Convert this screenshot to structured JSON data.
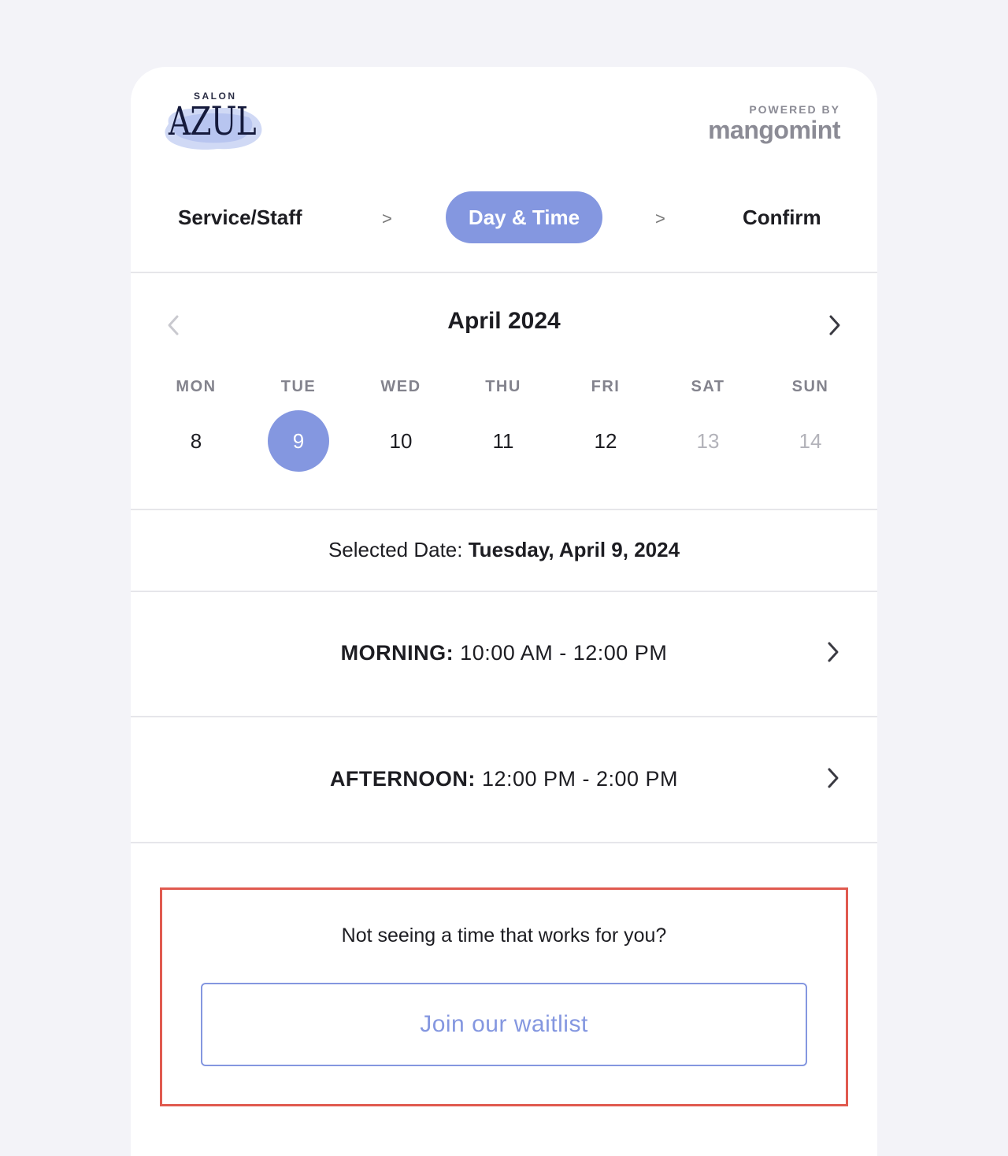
{
  "brand": {
    "logo_top": "SALON",
    "logo_name": "AZUL",
    "powered_label": "POWERED BY",
    "powered_brand": "mangomint"
  },
  "steps": [
    {
      "label": "Service/Staff",
      "active": false
    },
    {
      "label": "Day & Time",
      "active": true
    },
    {
      "label": "Confirm",
      "active": false
    }
  ],
  "step_separator": ">",
  "calendar": {
    "month": "April 2024",
    "weekdays": [
      "MON",
      "TUE",
      "WED",
      "THU",
      "FRI",
      "SAT",
      "SUN"
    ],
    "days": [
      {
        "num": "8",
        "state": "normal"
      },
      {
        "num": "9",
        "state": "selected"
      },
      {
        "num": "10",
        "state": "normal"
      },
      {
        "num": "11",
        "state": "normal"
      },
      {
        "num": "12",
        "state": "normal"
      },
      {
        "num": "13",
        "state": "muted"
      },
      {
        "num": "14",
        "state": "muted"
      }
    ]
  },
  "selected_date": {
    "label": "Selected Date:",
    "value": "Tuesday, April 9, 2024"
  },
  "time_slots": [
    {
      "period": "MORNING:",
      "range": "10:00 AM - 12:00 PM"
    },
    {
      "period": "AFTERNOON:",
      "range": "12:00 PM - 2:00 PM"
    }
  ],
  "waitlist": {
    "question": "Not seeing a time that works for you?",
    "button_label": "Join our waitlist"
  },
  "colors": {
    "accent": "#8497e0",
    "highlight_border": "#e05a4f",
    "background": "#f3f3f8"
  }
}
